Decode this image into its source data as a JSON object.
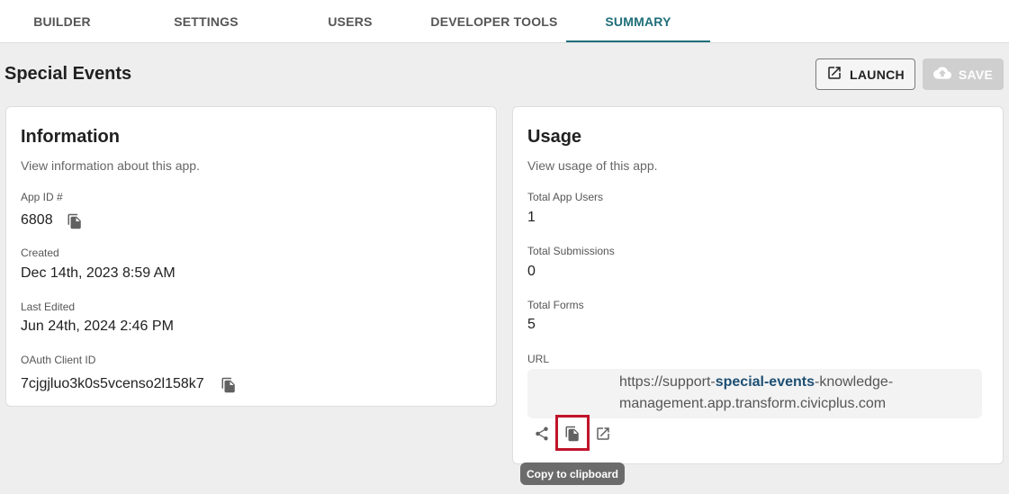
{
  "tabs": [
    {
      "label": "BUILDER",
      "active": false
    },
    {
      "label": "SETTINGS",
      "active": false
    },
    {
      "label": "USERS",
      "active": false
    },
    {
      "label": "DEVELOPER TOOLS",
      "active": false
    },
    {
      "label": "SUMMARY",
      "active": true
    }
  ],
  "page": {
    "title": "Special Events"
  },
  "toolbar": {
    "launch_label": "LAUNCH",
    "save_label": "SAVE"
  },
  "info": {
    "title": "Information",
    "subtitle": "View information about this app.",
    "app_id_label": "App ID #",
    "app_id": "6808",
    "created_label": "Created",
    "created": "Dec 14th, 2023 8:59 AM",
    "edited_label": "Last Edited",
    "edited": "Jun 24th, 2024 2:46 PM",
    "oauth_label": "OAuth Client ID",
    "oauth": "7cjgjluo3k0s5vcenso2l158k7"
  },
  "usage": {
    "title": "Usage",
    "subtitle": "View usage of this app.",
    "users_label": "Total App Users",
    "users": "1",
    "submissions_label": "Total Submissions",
    "submissions": "0",
    "forms_label": "Total Forms",
    "forms": "5",
    "url_label": "URL",
    "url_prefix": "https://support-",
    "url_highlight": "special-events",
    "url_suffix": "-knowledge-management.app.transform.civicplus.com"
  },
  "tooltip": {
    "text": "Copy to clipboard"
  },
  "colors": {
    "accent": "#1f6f7a",
    "focus": "#c0142a",
    "link": "#1c4f73"
  },
  "icons": {
    "launch": "open-in-new-icon",
    "save": "cloud-upload-icon",
    "copy": "copy-icon",
    "share": "share-icon",
    "external": "open-in-new-icon"
  }
}
